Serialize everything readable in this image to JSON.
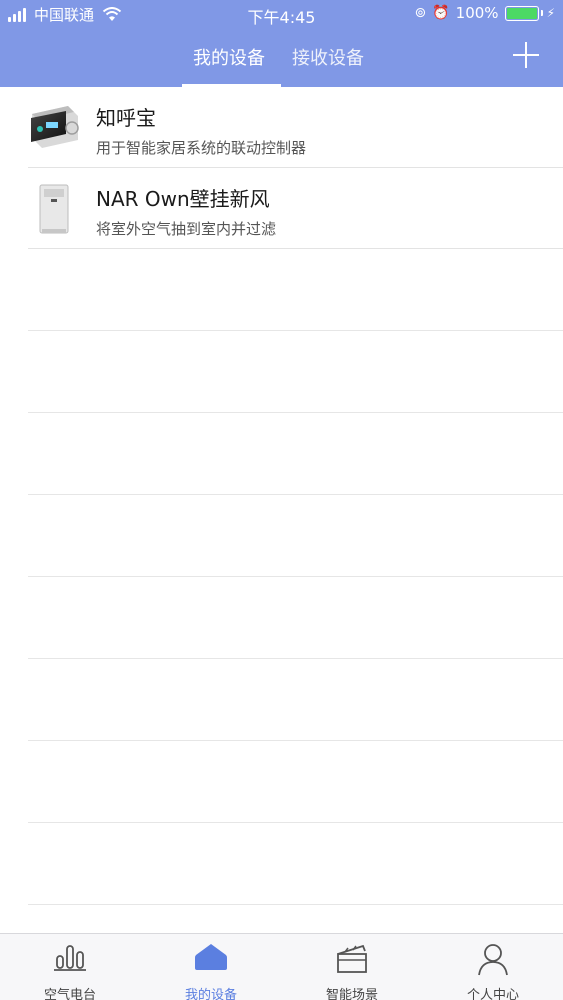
{
  "status_bar": {
    "carrier": "中国联通",
    "time": "下午4:45",
    "battery_percent": "100%"
  },
  "header": {
    "tabs": [
      {
        "label": "我的设备",
        "active": true
      },
      {
        "label": "接收设备",
        "active": false
      }
    ],
    "add_icon": "plus-icon"
  },
  "devices": [
    {
      "name": "知呼宝",
      "description": "用于智能家居系统的联动控制器",
      "icon": "controller-device-thumb"
    },
    {
      "name": "NAR Own壁挂新风",
      "description": "将室外空气抽到室内并过滤",
      "icon": "wall-ventilator-thumb"
    }
  ],
  "tabbar": {
    "items": [
      {
        "label": "空气电台",
        "icon": "bar-chart-icon",
        "active": false
      },
      {
        "label": "我的设备",
        "icon": "home-icon",
        "active": true
      },
      {
        "label": "智能场景",
        "icon": "clapperboard-icon",
        "active": false
      },
      {
        "label": "个人中心",
        "icon": "person-icon",
        "active": false
      }
    ]
  },
  "colors": {
    "header_bg": "#8098e6",
    "active_tab": "#5b7fe0",
    "battery": "#4cd964"
  }
}
